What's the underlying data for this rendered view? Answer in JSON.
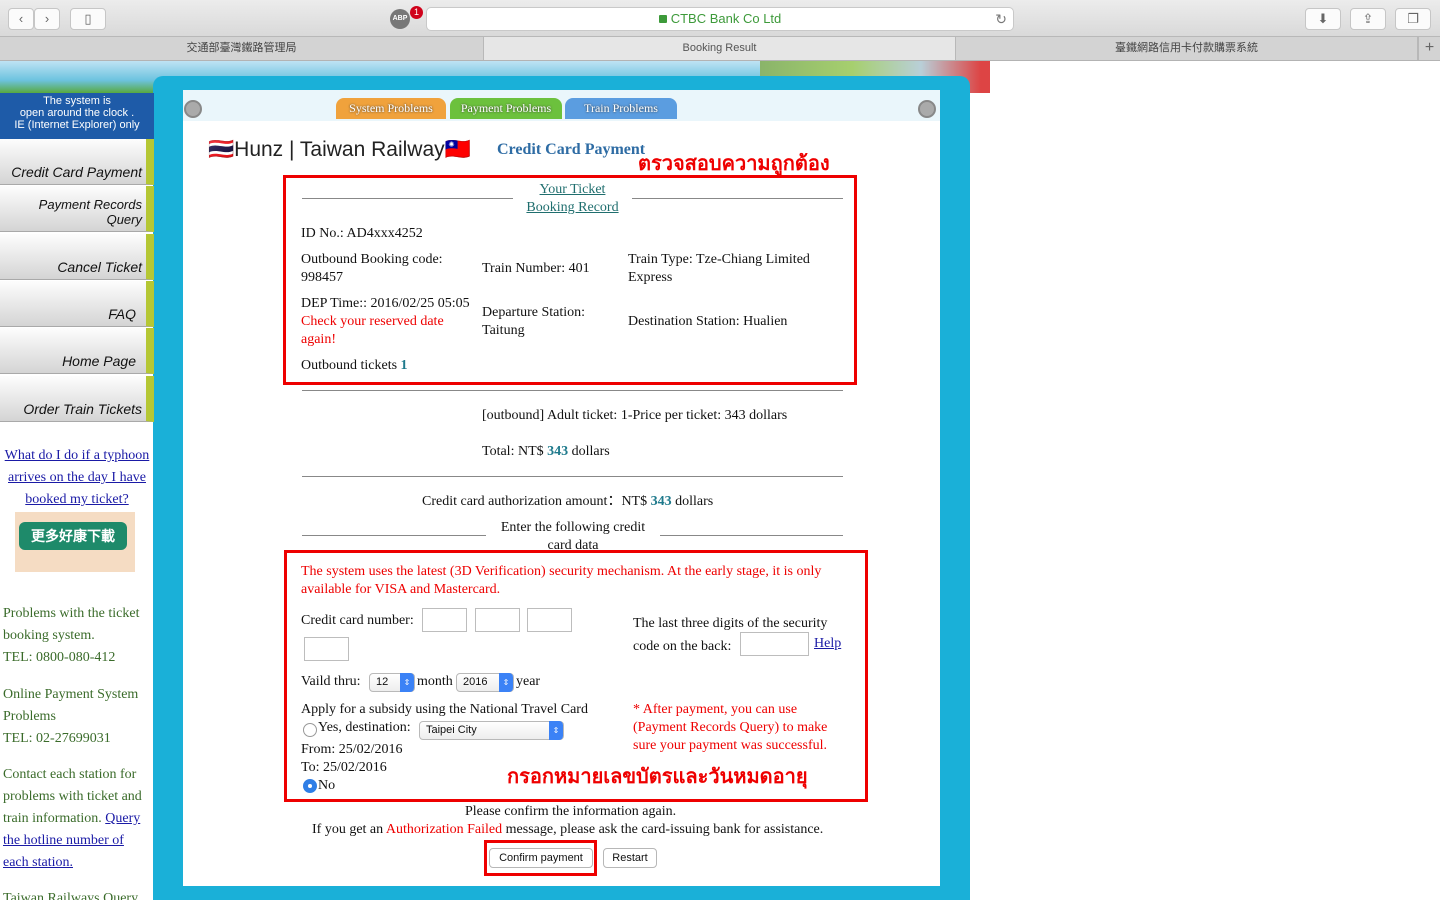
{
  "browser": {
    "url": "CTBC Bank Co Ltd",
    "abp_label": "ABP",
    "abp_count": "1",
    "tabs": [
      "交通部臺灣鐵路管理局",
      "Booking Result",
      "臺鐵網路信用卡付款購票系統"
    ],
    "new_tab": "+"
  },
  "sidebar": {
    "notice": [
      "The system is",
      "open around the clock .",
      "IE (Internet Explorer) only"
    ],
    "menu": [
      "Credit Card Payment",
      "Payment Records Query",
      "Cancel Ticket",
      "FAQ",
      "Home Page",
      "Order Train Tickets"
    ],
    "typhoon_link": [
      "What do I do if a typhoon",
      "arrives on the day I have",
      "booked my ticket?"
    ],
    "promo": "更多好康下載",
    "help1": [
      "Problems with the ticket",
      "booking system.",
      "TEL: 0800-080-412"
    ],
    "help2": [
      "Online Payment System",
      "Problems",
      "TEL: 02-27699031"
    ],
    "help3_text": [
      "Contact each station for",
      "problems with ticket and",
      "train information."
    ],
    "help3_link": [
      "Query",
      "the hotline number of",
      "each station."
    ],
    "help4": "Taiwan Railways Query"
  },
  "header": {
    "tabs": [
      "System Problems",
      "Payment Problems",
      "Train Problems"
    ],
    "logo": "🇹🇭Hunz | Taiwan Railway🇹🇼",
    "title": "Credit Card Payment",
    "annotation_top": "ตรวจสอบความถูกต้อง",
    "annotation_bottom": "กรอกหมายเลขบัตรและวันหมดอายุ"
  },
  "booking": {
    "heading": [
      "Your Ticket",
      "Booking Record"
    ],
    "id": "ID No.: AD4xxx4252",
    "outbound_code": [
      "Outbound Booking code:",
      "998457"
    ],
    "train_number": "Train Number: 401",
    "train_type": [
      "Train Type: Tze-Chiang Limited",
      "Express"
    ],
    "dep_time": "DEP Time:: 2016/02/25 05:05",
    "check_warning": [
      "Check your reserved date",
      "again!"
    ],
    "departure": [
      "Departure Station:",
      "Taitung"
    ],
    "destination": "Destination Station: Hualien",
    "outbound_tickets_label": "Outbound tickets",
    "outbound_tickets_count": "1"
  },
  "price": {
    "adult_line": "[outbound] Adult ticket: 1-Price per ticket: 343 dollars",
    "total_prefix": "Total: NT$",
    "total_value": "343",
    "total_suffix": "dollars",
    "auth_prefix": "Credit card authorization amount：NT$",
    "auth_value": "343",
    "auth_suffix": "dollars",
    "enter_label": [
      "Enter the following credit",
      "card data"
    ]
  },
  "card": {
    "security_note": [
      "The system uses the latest (3D Verification) security mechanism. At the early stage, it is only",
      "available for VISA and Mastercard."
    ],
    "number_label": "Credit card number:",
    "cvv_label": [
      "The last three digits of the security",
      "code on the back:"
    ],
    "help_link": "Help",
    "valid_label": "Vaild thru:",
    "month_value": "12",
    "month_label": "month",
    "year_value": "2016",
    "year_label": "year",
    "subsidy_label": "Apply for a subsidy using the National Travel Card",
    "yes_label": "Yes, destination:",
    "destination_value": "Taipei City",
    "from": "From: 25/02/2016",
    "to": "To: 25/02/2016",
    "no_label": "No",
    "after_payment": [
      "* After payment, you can use",
      "(Payment Records Query) to make",
      "sure your payment was successful."
    ]
  },
  "footer": {
    "confirm_text": "Please confirm the information again.",
    "auth_failed_prefix": "If you get an",
    "auth_failed_red": "Authorization Failed",
    "auth_failed_suffix": "message, please ask the card-issuing bank for assistance.",
    "confirm_button": "Confirm payment",
    "restart_button": "Restart"
  }
}
